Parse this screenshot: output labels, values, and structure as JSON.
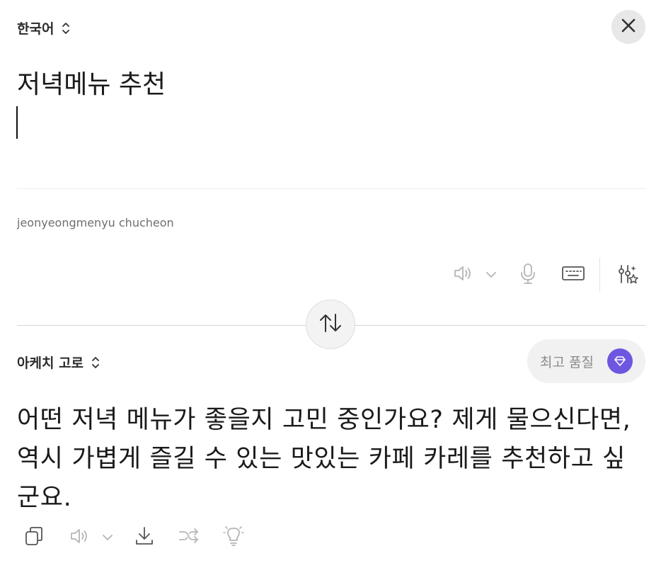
{
  "source": {
    "language_label": "한국어",
    "text": "저녁메뉴 추천",
    "romanization": "jeonyeongmenyu chucheon",
    "tools": [
      "speaker-icon",
      "chevron-down-icon",
      "microphone-icon",
      "keyboard-icon",
      "settings-sparkle-icon"
    ]
  },
  "target": {
    "language_label": "아케치 고로",
    "quality_label": "최고 품질",
    "text": "어떤 저녁 메뉴가 좋을지 고민 중인가요? 제게 물으신다면, 역시 가볍게 즐길 수 있는 맛있는 카페 카레를 추천하고 싶군요.",
    "tools": [
      "copy-icon",
      "speaker-icon",
      "chevron-down-icon",
      "download-icon",
      "shuffle-icon",
      "lightbulb-icon"
    ]
  },
  "colors": {
    "accent": "#6f56e0",
    "icon_gray": "#b5b5b5",
    "icon_dark": "#555555"
  }
}
